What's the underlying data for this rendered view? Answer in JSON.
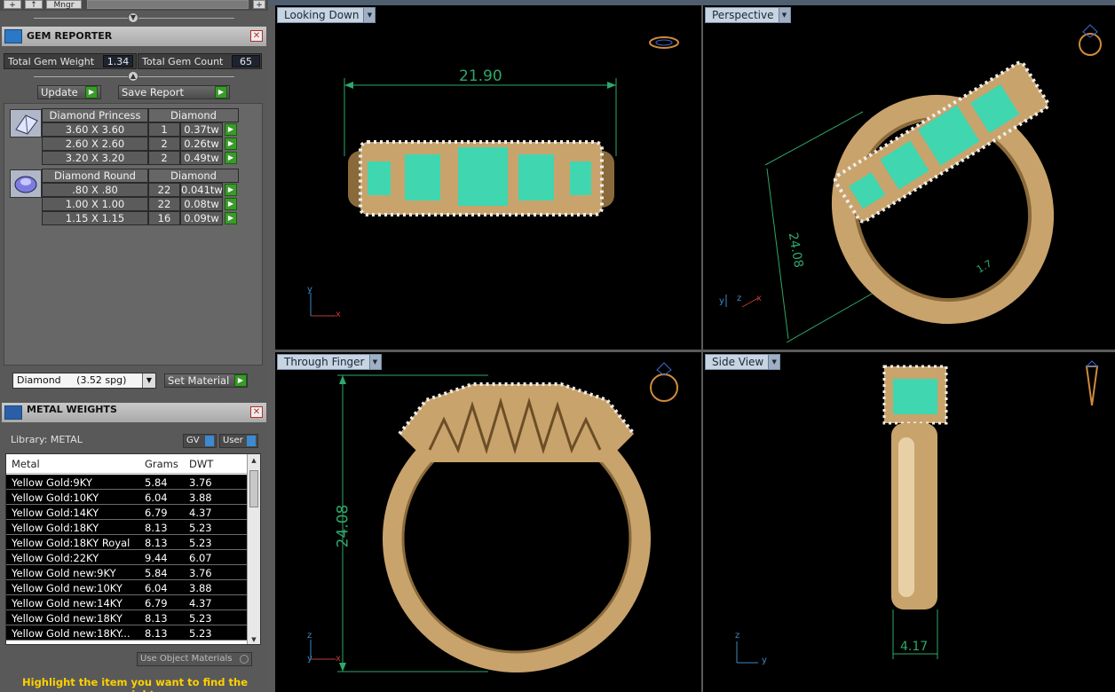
{
  "topbar": {
    "mngr_label": "Mngr"
  },
  "gem_reporter": {
    "title": "GEM REPORTER",
    "total_weight_label": "Total Gem Weight",
    "total_weight": "1.34",
    "total_count_label": "Total Gem Count",
    "total_count": "65",
    "update_label": "Update",
    "save_report_label": "Save Report",
    "groups": [
      {
        "shape": "Diamond Princess",
        "material": "Diamond",
        "rows": [
          {
            "size": "3.60 X 3.60",
            "qty": "1",
            "wt": "0.37tw"
          },
          {
            "size": "2.60 X 2.60",
            "qty": "2",
            "wt": "0.26tw"
          },
          {
            "size": "3.20 X 3.20",
            "qty": "2",
            "wt": "0.49tw"
          }
        ]
      },
      {
        "shape": "Diamond Round",
        "material": "Diamond",
        "rows": [
          {
            "size": ".80 X .80",
            "qty": "22",
            "wt": "0.041tw"
          },
          {
            "size": "1.00 X 1.00",
            "qty": "22",
            "wt": "0.08tw"
          },
          {
            "size": "1.15 X 1.15",
            "qty": "16",
            "wt": "0.09tw"
          }
        ]
      }
    ],
    "material_select": "Diamond     (3.52 spg)",
    "set_material_label": "Set Material"
  },
  "metal_weights": {
    "title": "METAL WEIGHTS",
    "library_label": "Library: METAL",
    "gv_label": "GV",
    "user_label": "User",
    "columns": [
      "Metal",
      "Grams",
      "DWT"
    ],
    "rows": [
      [
        "Yellow Gold:9KY",
        "5.84",
        "3.76"
      ],
      [
        "Yellow Gold:10KY",
        "6.04",
        "3.88"
      ],
      [
        "Yellow Gold:14KY",
        "6.79",
        "4.37"
      ],
      [
        "Yellow Gold:18KY",
        "8.13",
        "5.23"
      ],
      [
        "Yellow Gold:18KY Royal",
        "8.13",
        "5.23"
      ],
      [
        "Yellow Gold:22KY",
        "9.44",
        "6.07"
      ],
      [
        "Yellow Gold new:9KY",
        "5.84",
        "3.76"
      ],
      [
        "Yellow Gold new:10KY",
        "6.04",
        "3.88"
      ],
      [
        "Yellow Gold new:14KY",
        "6.79",
        "4.37"
      ],
      [
        "Yellow Gold new:18KY",
        "8.13",
        "5.23"
      ],
      [
        "Yellow Gold new:18KY...",
        "8.13",
        "5.23"
      ]
    ],
    "use_object_materials": "Use Object Materials",
    "hint": "Highlight the item you want to find the weight"
  },
  "viewports": {
    "top_left": {
      "title": "Looking Down",
      "dimension": "21.90"
    },
    "top_right": {
      "title": "Perspective",
      "dimension": "24.08",
      "dimension2": "1.7"
    },
    "bottom_left": {
      "title": "Through Finger",
      "dimension": "24.08"
    },
    "bottom_right": {
      "title": "Side View",
      "dimension": "4.17"
    }
  },
  "colors": {
    "accent_green": "#2ea86a",
    "gold": "#c9a36c",
    "gem": "#3fd6b0"
  }
}
